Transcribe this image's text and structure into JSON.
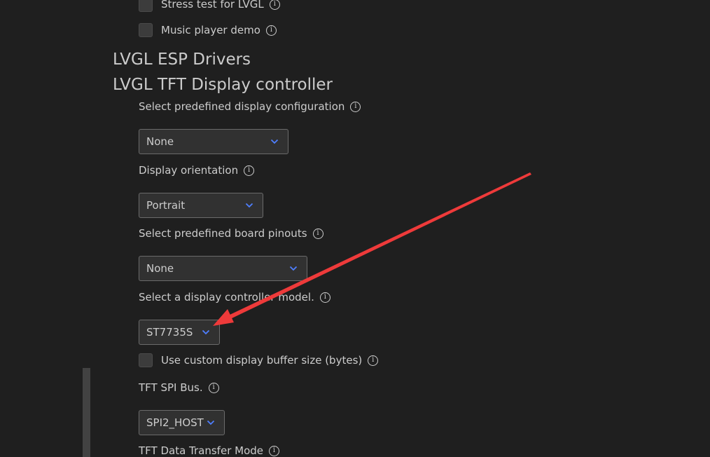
{
  "settings": {
    "stress_test": {
      "label": "Stress test for LVGL"
    },
    "music_player": {
      "label": "Music player demo"
    },
    "heading_drivers": "LVGL ESP Drivers",
    "heading_tft": "LVGL TFT Display controller",
    "predefined_display": {
      "label": "Select predefined display configuration",
      "value": "None"
    },
    "orientation": {
      "label": "Display orientation",
      "value": "Portrait"
    },
    "board_pinouts": {
      "label": "Select predefined board pinouts",
      "value": "None"
    },
    "controller_model": {
      "label": "Select a display controller model.",
      "value": "ST7735S"
    },
    "custom_buffer": {
      "label": "Use custom display buffer size (bytes)"
    },
    "spi_bus": {
      "label": "TFT SPI Bus.",
      "value": "SPI2_HOST"
    },
    "transfer_mode": {
      "label": "TFT Data Transfer Mode"
    }
  },
  "icons": {
    "info": "info-icon",
    "chevron": "chevron-down-icon"
  },
  "colors": {
    "background": "#1f1f1f",
    "text": "#cccccc",
    "dropdown_bg": "#313131",
    "dropdown_border": "#6b6b6b",
    "chevron": "#4e7fff",
    "annotation_arrow": "#ee3a3a"
  }
}
